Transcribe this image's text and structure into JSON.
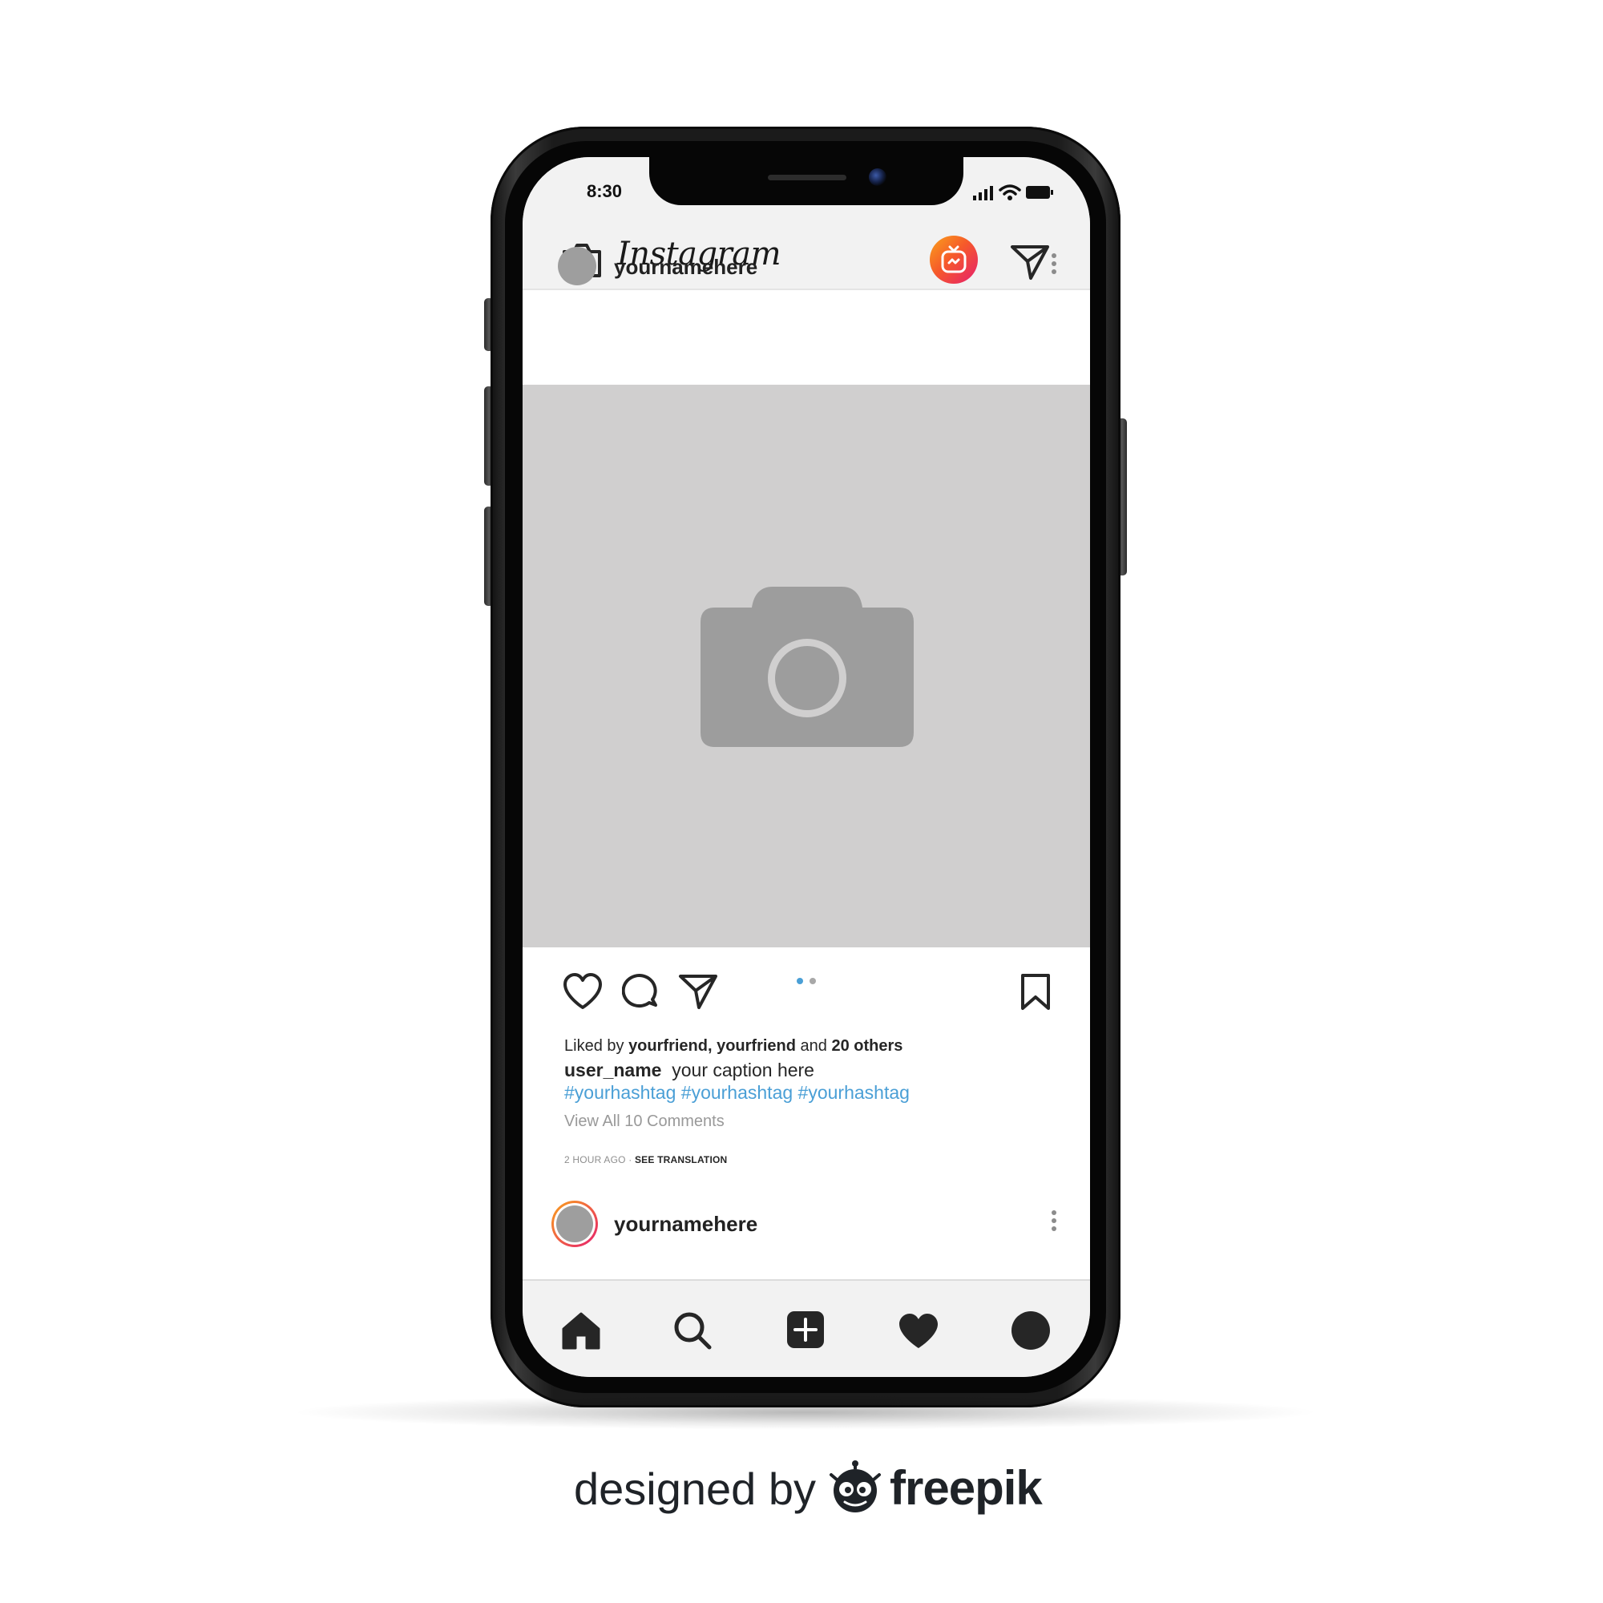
{
  "status_bar": {
    "time": "8:30",
    "icons": [
      "signal-icon",
      "wifi-icon",
      "battery-icon"
    ]
  },
  "header": {
    "app_name": "Instagram",
    "icons": [
      "camera-icon",
      "igtv-icon",
      "direct-message-icon"
    ],
    "accent_gradient": [
      "#f9a21b",
      "#f65a2a",
      "#e61e6e"
    ]
  },
  "post": {
    "username": "yournamehere",
    "image_placeholder_icon": "camera-placeholder-icon",
    "carousel_dots": {
      "count": 2,
      "active_index": 0,
      "active_color": "#4a9fd6"
    },
    "likes": {
      "prefix": "Liked by ",
      "names": "yourfriend, yourfriend",
      "and": " and ",
      "others": "20 others"
    },
    "caption_user": "user_name",
    "caption_text": "your caption here",
    "hashtags": "#yourhashtag #yourhashtag #yourhashtag",
    "view_comments": "View All 10 Comments",
    "time_ago": "2 HOUR AGO",
    "separator": " · ",
    "see_translation": "SEE TRANSLATION",
    "hashtag_color": "#4a9fd6"
  },
  "next_post": {
    "username": "yournamehere"
  },
  "bottom_nav": {
    "items": [
      "home-icon",
      "search-icon",
      "add-post-icon",
      "activity-heart-icon",
      "profile-icon"
    ]
  },
  "credit": {
    "text": "designed by",
    "brand": "freepik"
  }
}
